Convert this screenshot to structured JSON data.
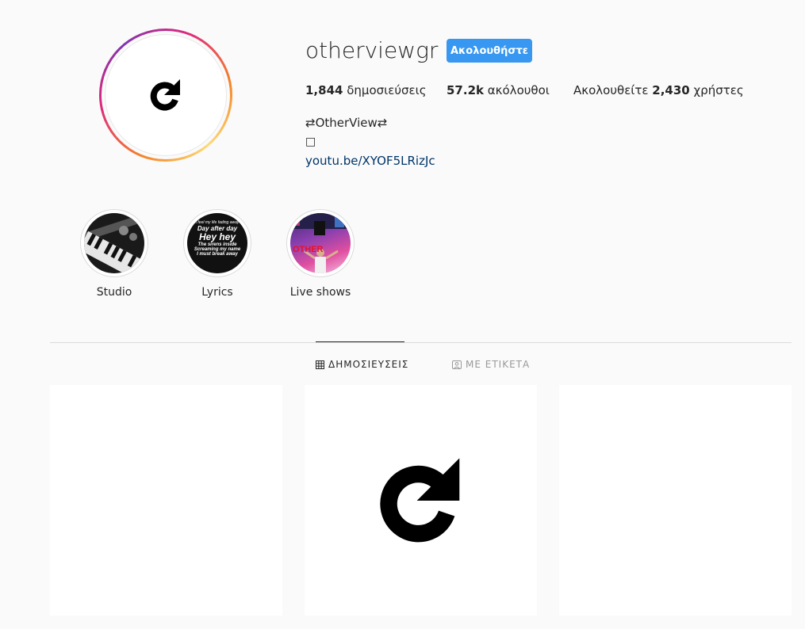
{
  "profile": {
    "username": "otherviewgr",
    "follow_label": "Ακολουθήστε",
    "posts_count": "1,844",
    "posts_label": "δημοσιεύσεις",
    "followers_count": "57.2k",
    "followers_label": "ακόλουθοι",
    "following_prefix": "Ακολουθείτε",
    "following_count": "2,430",
    "following_suffix": "χρήστες",
    "bio_name": "⇄OtherView⇄",
    "bio_glyph": "□",
    "bio_link": "youtu.be/XYOF5LRizJc",
    "avatar_icon": "refresh-icon"
  },
  "highlights": [
    {
      "label": "Studio"
    },
    {
      "label": "Lyrics",
      "cover_text": [
        "I feel my life fading away",
        "Day after day",
        "Hey hey",
        "The sirens inside",
        "Screaming my name",
        "I must break away"
      ]
    },
    {
      "label": "Live shows",
      "cover_text": [
        "OTHER"
      ]
    }
  ],
  "tabs": [
    {
      "label": "ΔΗΜΟΣΙΕΥΣΕΙΣ",
      "icon": "grid-icon",
      "active": true
    },
    {
      "label": "ΜΕ ΕΤΙΚΕΤΑ",
      "icon": "tagged-icon",
      "active": false
    }
  ],
  "colors": {
    "follow_button": "#3897f0",
    "link": "#003569",
    "background": "#fafafa",
    "divider": "#dbdbdb"
  }
}
